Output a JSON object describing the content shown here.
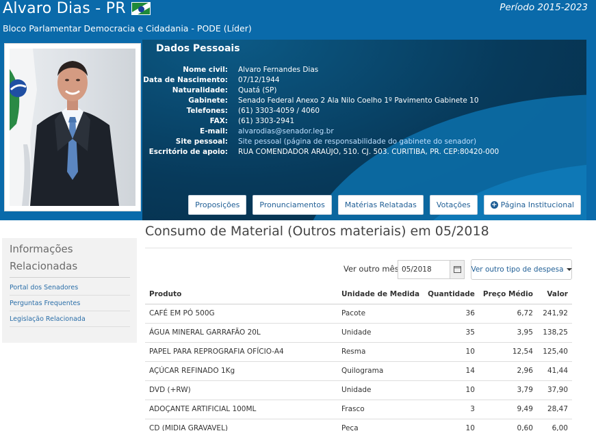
{
  "header": {
    "senator_name": "Alvaro Dias - PR",
    "periodo": "Período 2015-2023",
    "bloco": "Bloco Parlamentar Democracia e Cidadania - PODE (Líder)"
  },
  "dados_pessoais": {
    "title": "Dados Pessoais",
    "rows": [
      {
        "label": "Nome civil:",
        "value": "Alvaro Fernandes Dias"
      },
      {
        "label": "Data de Nascimento:",
        "value": "07/12/1944"
      },
      {
        "label": "Naturalidade:",
        "value": "Quatá (SP)"
      },
      {
        "label": "Gabinete:",
        "value": "Senado Federal Anexo 2 Ala Nilo Coelho 1º Pavimento Gabinete 10"
      },
      {
        "label": "Telefones:",
        "value": "(61) 3303-4059 / 4060"
      },
      {
        "label": "FAX:",
        "value": "(61) 3303-2941"
      },
      {
        "label": "E-mail:",
        "value": "alvarodias@senador.leg.br"
      },
      {
        "label": "Site pessoal:",
        "value": "Site pessoal (página de responsabilidade do gabinete do senador)"
      },
      {
        "label": "Escritório de apoio:",
        "value": "RUA COMENDADOR ARAÚJO, 510. CJ. 503. CURITIBA, PR. CEP:80420-000"
      }
    ],
    "buttons": {
      "proposicoes": "Proposições",
      "pronunciamentos": "Pronunciamentos",
      "materias": "Matérias Relatadas",
      "votacoes": "Votações",
      "institucional": "Página Institucional"
    }
  },
  "sidebar": {
    "title": "Informações Relacionadas",
    "links": [
      "Portal dos Senadores",
      "Perguntas Frequentes",
      "Legislação Relacionada"
    ]
  },
  "main": {
    "title": "Consumo de Material (Outros materiais) em 05/2018",
    "filter_label": "Ver outro mês:",
    "month_value": "05/2018",
    "type_button": "Ver outro tipo de despesa"
  },
  "table": {
    "headers": {
      "produto": "Produto",
      "unidade": "Unidade de Medida",
      "quantidade": "Quantidade",
      "preco": "Preço Médio",
      "valor": "Valor"
    },
    "rows": [
      {
        "produto": "CAFÉ EM PÓ 500G",
        "unidade": "Pacote",
        "quantidade": "36",
        "preco": "6,72",
        "valor": "241,92"
      },
      {
        "produto": "ÁGUA MINERAL GARRAFÃO 20L",
        "unidade": "Unidade",
        "quantidade": "35",
        "preco": "3,95",
        "valor": "138,25"
      },
      {
        "produto": "PAPEL PARA REPROGRAFIA OFÍCIO-A4",
        "unidade": "Resma",
        "quantidade": "10",
        "preco": "12,54",
        "valor": "125,40"
      },
      {
        "produto": "AÇÚCAR REFINADO 1Kg",
        "unidade": "Quilograma",
        "quantidade": "14",
        "preco": "2,96",
        "valor": "41,44"
      },
      {
        "produto": "DVD (+RW)",
        "unidade": "Unidade",
        "quantidade": "10",
        "preco": "3,79",
        "valor": "37,90"
      },
      {
        "produto": "ADOÇANTE ARTIFICIAL 100ML",
        "unidade": "Frasco",
        "quantidade": "3",
        "preco": "9,49",
        "valor": "28,47"
      },
      {
        "produto": "CD (MIDIA GRAVAVEL)",
        "unidade": "Peça",
        "quantidade": "10",
        "preco": "0,60",
        "valor": "6,00"
      }
    ]
  },
  "colors": {
    "header_blue": "#0a6aaa",
    "panel_dark": "#073a5b",
    "link_blue": "#2a6ea8"
  }
}
